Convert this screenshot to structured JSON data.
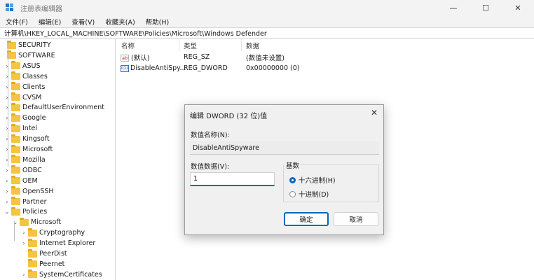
{
  "window": {
    "title": "注册表编辑器",
    "minimize_glyph": "—",
    "maximize_glyph": "☐",
    "close_glyph": "✕"
  },
  "menu": [
    "文件(F)",
    "编辑(E)",
    "查看(V)",
    "收藏夹(A)",
    "帮助(H)"
  ],
  "address": "计算机\\HKEY_LOCAL_MACHINE\\SOFTWARE\\Policies\\Microsoft\\Windows Defender",
  "tree": {
    "items": [
      {
        "label": "SECURITY",
        "chev": "",
        "level": 0
      },
      {
        "label": "SOFTWARE",
        "chev": "",
        "level": 0
      },
      {
        "label": "ASUS",
        "chev": "›",
        "level": 1
      },
      {
        "label": "Classes",
        "chev": "›",
        "level": 1
      },
      {
        "label": "Clients",
        "chev": "›",
        "level": 1
      },
      {
        "label": "CVSM",
        "chev": "›",
        "level": 1
      },
      {
        "label": "DefaultUserEnvironment",
        "chev": "›",
        "level": 1
      },
      {
        "label": "Google",
        "chev": "›",
        "level": 1
      },
      {
        "label": "Intel",
        "chev": "›",
        "level": 1
      },
      {
        "label": "Kingsoft",
        "chev": "›",
        "level": 1
      },
      {
        "label": "Microsoft",
        "chev": "›",
        "level": 1
      },
      {
        "label": "Mozilla",
        "chev": "›",
        "level": 1
      },
      {
        "label": "ODBC",
        "chev": "›",
        "level": 1
      },
      {
        "label": "OEM",
        "chev": "›",
        "level": 1
      },
      {
        "label": "OpenSSH",
        "chev": "›",
        "level": 1
      },
      {
        "label": "Partner",
        "chev": "›",
        "level": 1
      },
      {
        "label": "Policies",
        "chev": "⌄",
        "level": 1
      },
      {
        "label": "Microsoft",
        "chev": "⌄",
        "level": 2
      },
      {
        "label": "Cryptography",
        "chev": "›",
        "level": 3
      },
      {
        "label": "Internet Explorer",
        "chev": "›",
        "level": 3
      },
      {
        "label": "PeerDist",
        "chev": "",
        "level": 3
      },
      {
        "label": "Peernet",
        "chev": "",
        "level": 3
      },
      {
        "label": "SystemCertificates",
        "chev": "›",
        "level": 3
      }
    ]
  },
  "list": {
    "headers": {
      "name": "名称",
      "type": "类型",
      "data": "数据"
    },
    "rows": [
      {
        "icon": "ab",
        "name": "(默认)",
        "type": "REG_SZ",
        "data": "(数值未设置)"
      },
      {
        "icon": "011",
        "name": "DisableAntiSpy...",
        "type": "REG_DWORD",
        "data": "0x00000000 (0)"
      }
    ]
  },
  "dialog": {
    "title": "编辑 DWORD (32 位)值",
    "close_glyph": "✕",
    "name_label": "数值名称(N):",
    "name_value": "DisableAntiSpyware",
    "data_label": "数值数据(V):",
    "data_value": "1",
    "base_label": "基数",
    "radio_hex": "十六进制(H)",
    "radio_dec": "十进制(D)",
    "ok_label": "确定",
    "cancel_label": "取消"
  }
}
